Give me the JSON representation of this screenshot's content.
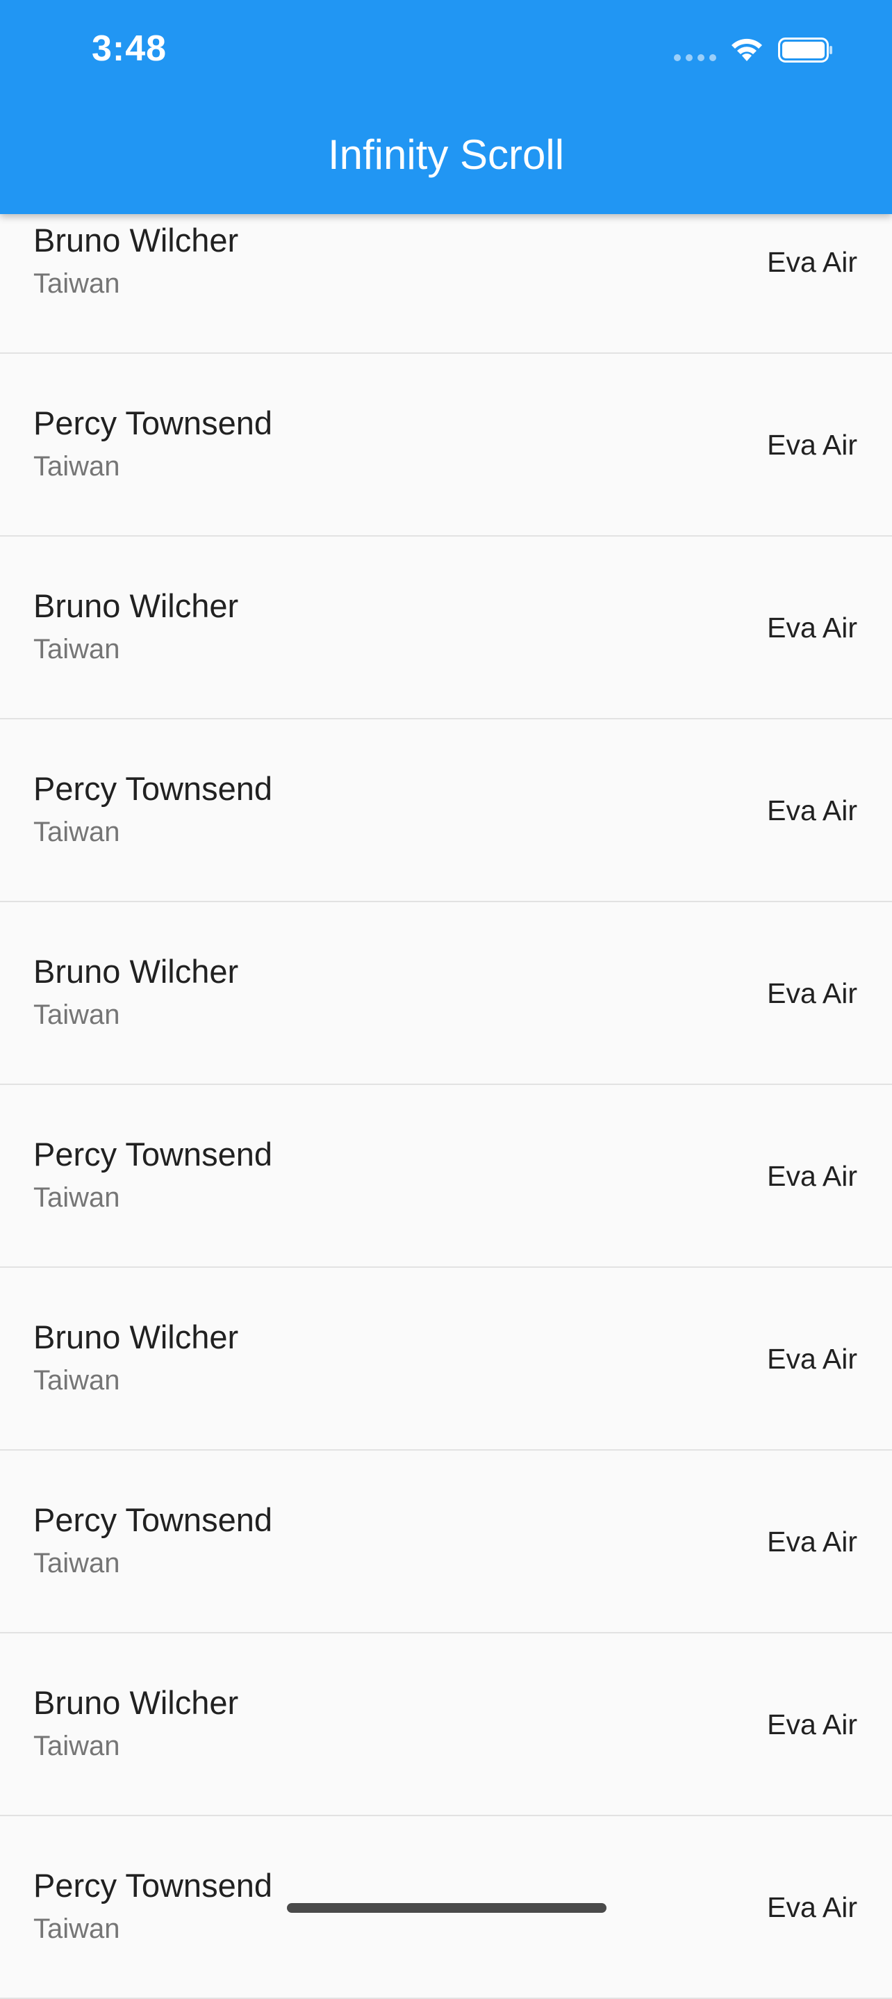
{
  "status_bar": {
    "time": "3:48",
    "icons": [
      "signal-dots-icon",
      "wifi-icon",
      "battery-icon"
    ]
  },
  "app_bar": {
    "title": "Infinity Scroll",
    "color": "#2196f3"
  },
  "list": {
    "rows": [
      {
        "name": "Bruno Wilcher",
        "country": "Taiwan",
        "airline": "Eva Air"
      },
      {
        "name": "Percy Townsend",
        "country": "Taiwan",
        "airline": "Eva Air"
      },
      {
        "name": "Bruno Wilcher",
        "country": "Taiwan",
        "airline": "Eva Air"
      },
      {
        "name": "Percy Townsend",
        "country": "Taiwan",
        "airline": "Eva Air"
      },
      {
        "name": "Bruno Wilcher",
        "country": "Taiwan",
        "airline": "Eva Air"
      },
      {
        "name": "Percy Townsend",
        "country": "Taiwan",
        "airline": "Eva Air"
      },
      {
        "name": "Bruno Wilcher",
        "country": "Taiwan",
        "airline": "Eva Air"
      },
      {
        "name": "Percy Townsend",
        "country": "Taiwan",
        "airline": "Eva Air"
      },
      {
        "name": "Bruno Wilcher",
        "country": "Taiwan",
        "airline": "Eva Air"
      },
      {
        "name": "Percy Townsend",
        "country": "Taiwan",
        "airline": "Eva Air"
      }
    ]
  }
}
